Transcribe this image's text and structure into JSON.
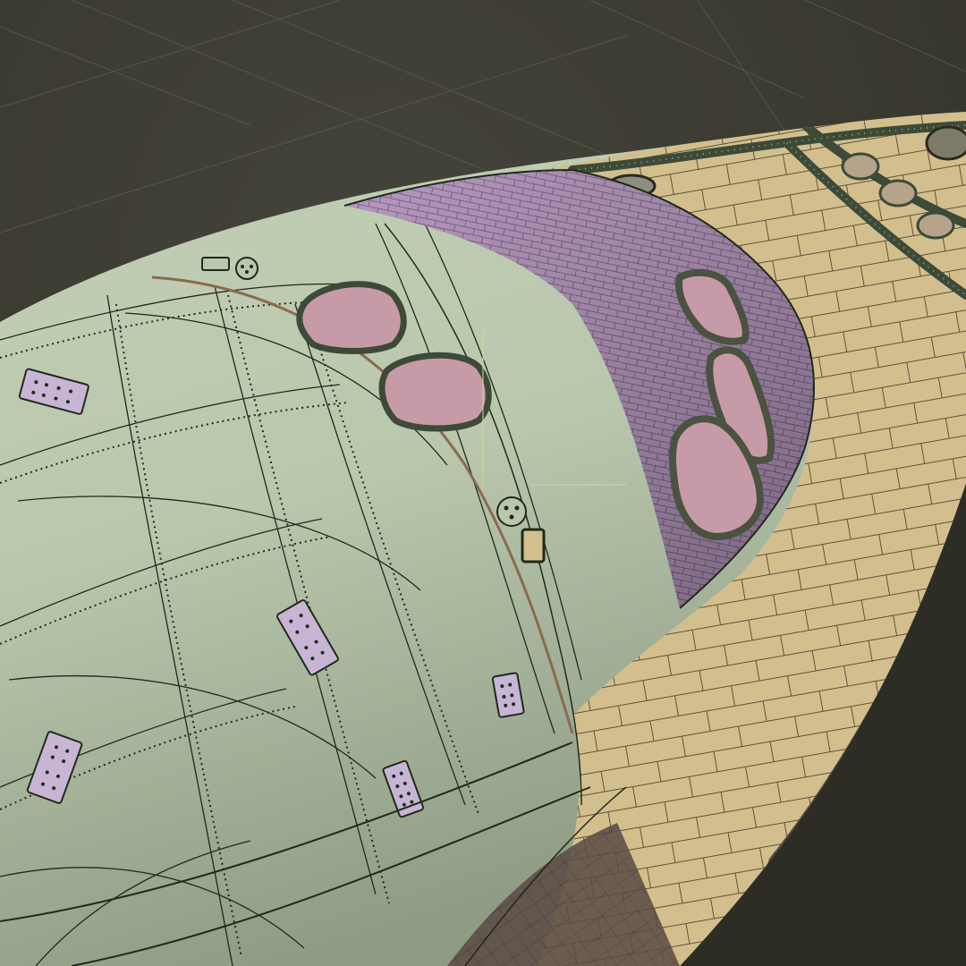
{
  "viewport": {
    "background": "#3b3a30",
    "grid_line_color": "#56554a"
  },
  "model": {
    "fuselage_color": "#b9c7ad",
    "fuselage_shade": "#8e9c84",
    "tile_color": "#b89ac0",
    "tile_line_color": "#6f5a7a",
    "window_color": "#c79aa8",
    "blanket_color": "#d3bf8e",
    "blanket_line_color": "#5e523a",
    "panel_line_color": "#1f2a1c",
    "hatch_color": "#c8b5d6",
    "underside_color": "#5a4a44"
  },
  "icons": {
    "origin_cursor": "crosshair-icon",
    "port_marker": "port-marker-icon",
    "rivet_hatch": "access-hatch-icon"
  }
}
